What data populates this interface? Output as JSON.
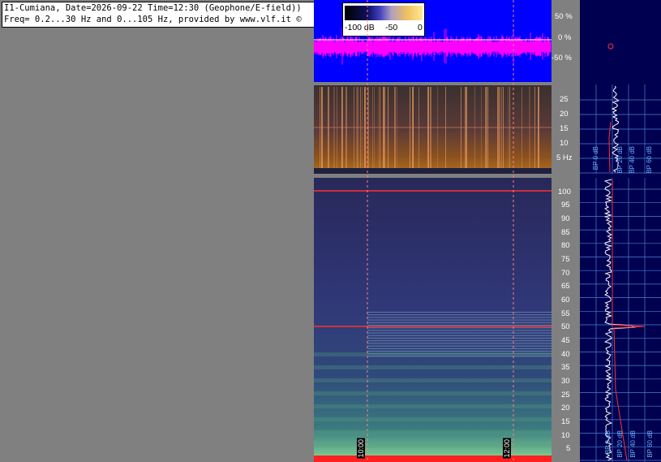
{
  "header": {
    "line1": "I1-Cumiana, Date=2026-09-22 Time=12:30 (Geophone/E-field))",
    "line2": "Freq= 0.2...30 Hz and 0...105 Hz, provided by www.vlf.it ©"
  },
  "colorscale": {
    "labels": [
      "-100 dB",
      "-50",
      "0"
    ]
  },
  "colors": {
    "waveform": "#ff00ff",
    "wave_bg": "#0000ff",
    "marker": "#ff4040",
    "spectrum_bg": "#000050"
  },
  "time_markers": [
    "10:00",
    "12:00"
  ],
  "chart_data": [
    {
      "type": "line",
      "name": "waveform",
      "yticks": [
        "50 %",
        "0 %",
        "-50 %"
      ],
      "ylim": [
        -100,
        100
      ]
    },
    {
      "type": "heatmap",
      "name": "spectrogram-low",
      "ylim": [
        0.2,
        30
      ],
      "yticks": [
        "25",
        "20",
        "15",
        "10",
        "5 Hz"
      ],
      "features_hz": [
        15.8
      ]
    },
    {
      "type": "heatmap",
      "name": "spectrogram-high",
      "ylim": [
        0,
        105
      ],
      "yticks": [
        "100",
        "95",
        "90",
        "85",
        "80",
        "75",
        "70",
        "65",
        "60",
        "55",
        "50",
        "45",
        "40",
        "35",
        "30",
        "25",
        "20",
        "15",
        "10",
        "5"
      ],
      "features_hz": [
        50,
        100
      ]
    },
    {
      "type": "line",
      "name": "spectrum-profile",
      "bp_labels": [
        "BP 0 dB",
        "BP 20 dB",
        "BP 40 dB",
        "BP 60 dB"
      ]
    }
  ]
}
